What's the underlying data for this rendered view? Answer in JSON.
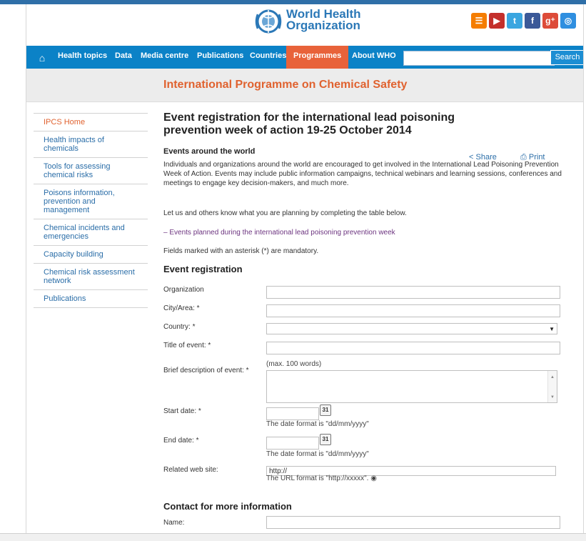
{
  "header": {
    "org_line1": "World Health",
    "org_line2": "Organization",
    "social_icons": [
      "rss-icon",
      "youtube-icon",
      "twitter-icon",
      "facebook-icon",
      "googleplus-icon",
      "app-icon"
    ]
  },
  "nav": {
    "items": [
      "Health topics",
      "Data",
      "Media centre",
      "Publications",
      "Countries",
      "Programmes",
      "About WHO"
    ],
    "active": "Programmes",
    "search_label": "Search",
    "search_value": ""
  },
  "banner": {
    "title": "International Programme on Chemical Safety"
  },
  "sidebar": {
    "items": [
      "IPCS Home",
      "Health impacts of chemicals",
      "Tools for assessing chemical risks",
      "Poisons information, prevention and management",
      "Chemical incidents and emergencies",
      "Capacity building",
      "Chemical risk assessment network",
      "Publications"
    ]
  },
  "article": {
    "title": "Event registration for the international lead poisoning prevention week of action 19-25 October 2014",
    "share": "Share",
    "print": "Print",
    "subheading": "Events around the world",
    "paragraph": "Individuals and organizations around the world are encouraged to get involved in the International Lead Poisoning Prevention Week of Action. Events may include public information campaigns, technical webinars and learning sessions, conferences and meetings to engage key decision-makers, and much more.",
    "paragraph2": "Let us and others know what you are planning by completing the table below.",
    "link": "Events planned during the international lead poisoning prevention week",
    "mandatory": "Fields marked with an asterisk (*) are mandatory."
  },
  "form": {
    "heading": "Event registration",
    "organization": "Organization",
    "city": "City/Area: *",
    "country": "Country: *",
    "title": "Title of event: *",
    "description": "Brief description of event: *",
    "description_hint": "(max. 100 words)",
    "start_date": "Start date: *",
    "end_date": "End date: *",
    "date_hint": "The date format is \"dd/mm/yyyy\"",
    "website": "Related web site:",
    "website_value": "http://",
    "url_hint": "The URL format is \"http://xxxxx\".",
    "contact_heading": "Contact for more information",
    "name": "Name:"
  }
}
